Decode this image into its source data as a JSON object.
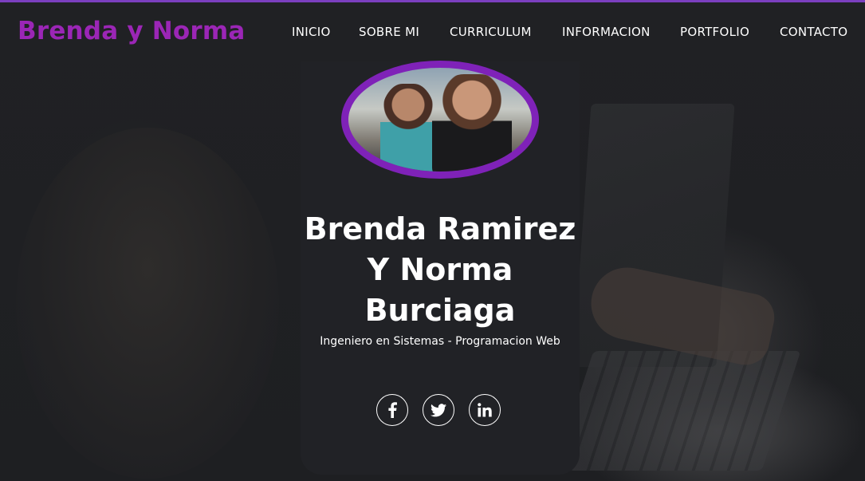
{
  "brand": "Brenda y Norma",
  "nav": {
    "items": [
      {
        "label": "INICIO"
      },
      {
        "label": "SOBRE MI"
      },
      {
        "label": "CURRICULUM"
      },
      {
        "label": "INFORMACION"
      },
      {
        "label": "PORTFOLIO"
      },
      {
        "label": "CONTACTO"
      }
    ]
  },
  "profile": {
    "name_line1": "Brenda Ramirez",
    "name_line2": "Y Norma",
    "name_line3": "Burciaga",
    "subtitle": "Ingeniero en Sistemas - Programacion Web"
  },
  "socials": [
    {
      "icon": "facebook-icon"
    },
    {
      "icon": "twitter-icon"
    },
    {
      "icon": "linkedin-icon"
    }
  ],
  "colors": {
    "accent": "#9b26b6",
    "avatar_ring": "#7f22b8",
    "background": "#1c1d20",
    "card": "#212226",
    "text": "#ffffff"
  }
}
